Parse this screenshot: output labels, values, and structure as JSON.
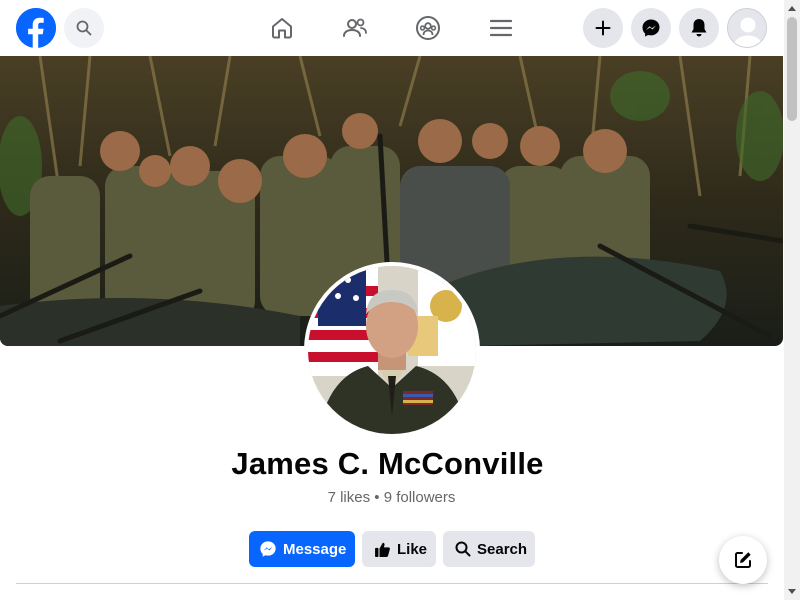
{
  "nav": {
    "logo_icon": "facebook-logo-icon",
    "search_icon": "search-icon",
    "center_icons": [
      "home-icon",
      "friends-icon",
      "groups-icon",
      "menu-icon"
    ],
    "right_icons": [
      "plus-icon",
      "messenger-icon",
      "bell-icon",
      "user-avatar-icon"
    ]
  },
  "profile": {
    "name": "James C. McConville",
    "stats": "7 likes • 9 followers"
  },
  "actions": {
    "message_label": "Message",
    "like_label": "Like",
    "search_label": "Search"
  },
  "colors": {
    "brand_blue": "#0866ff",
    "secondary_button": "#e4e6eb",
    "muted_text": "#65676b"
  }
}
